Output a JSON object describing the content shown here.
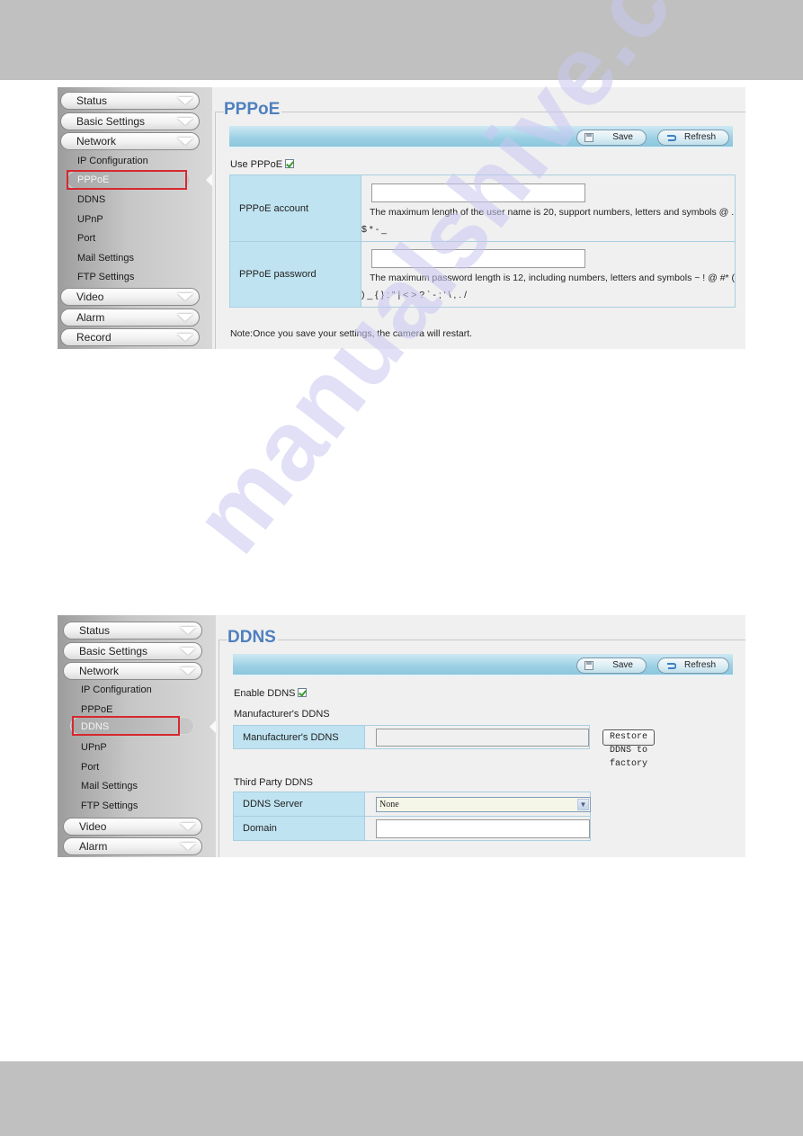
{
  "watermark": "manualshive.com",
  "pppoe_panel": {
    "sidebar": {
      "sections": [
        {
          "label": "Status"
        },
        {
          "label": "Basic Settings"
        },
        {
          "label": "Network"
        },
        {
          "label": "Video"
        },
        {
          "label": "Alarm"
        },
        {
          "label": "Record"
        }
      ],
      "network_items": [
        "IP Configuration",
        "PPPoE",
        "DDNS",
        "UPnP",
        "Port",
        "Mail Settings",
        "FTP Settings"
      ],
      "active_item": "PPPoE"
    },
    "title": "PPPoE",
    "toolbar": {
      "save_label": "Save",
      "refresh_label": "Refresh"
    },
    "use_pppoe": {
      "label": "Use PPPoE",
      "checked": true
    },
    "fields": [
      {
        "label": "PPPoE account",
        "value": "",
        "hint_line1": "The maximum length of the user name is 20, support numbers, letters and symbols @ .",
        "hint_line2": "$ * - _"
      },
      {
        "label": "PPPoE password",
        "value": "",
        "hint_line1": "The maximum password length is 12, including numbers, letters and symbols ~ ! @ #* (",
        "hint_line2": ") _ { } : \" | < > ? ` - ; ' \\ , . /"
      }
    ],
    "note": "Note:Once you save your settings, the camera will restart."
  },
  "ddns_panel": {
    "sidebar": {
      "sections": [
        {
          "label": "Status"
        },
        {
          "label": "Basic Settings"
        },
        {
          "label": "Network"
        },
        {
          "label": "Video"
        },
        {
          "label": "Alarm"
        }
      ],
      "network_items": [
        "IP Configuration",
        "PPPoE",
        "DDNS",
        "UPnP",
        "Port",
        "Mail Settings",
        "FTP Settings"
      ],
      "active_item": "DDNS"
    },
    "title": "DDNS",
    "toolbar": {
      "save_label": "Save",
      "refresh_label": "Refresh"
    },
    "enable_ddns": {
      "label": "Enable DDNS",
      "checked": true
    },
    "manufacturer_heading": "Manufacturer's DDNS",
    "manufacturer_row": {
      "label": "Manufacturer's DDNS",
      "value": "",
      "restore_label": "Restore DDNS to factory"
    },
    "third_party_heading": "Third Party DDNS",
    "ddns_server": {
      "label": "DDNS Server",
      "selected": "None"
    },
    "domain": {
      "label": "Domain",
      "value": ""
    }
  }
}
